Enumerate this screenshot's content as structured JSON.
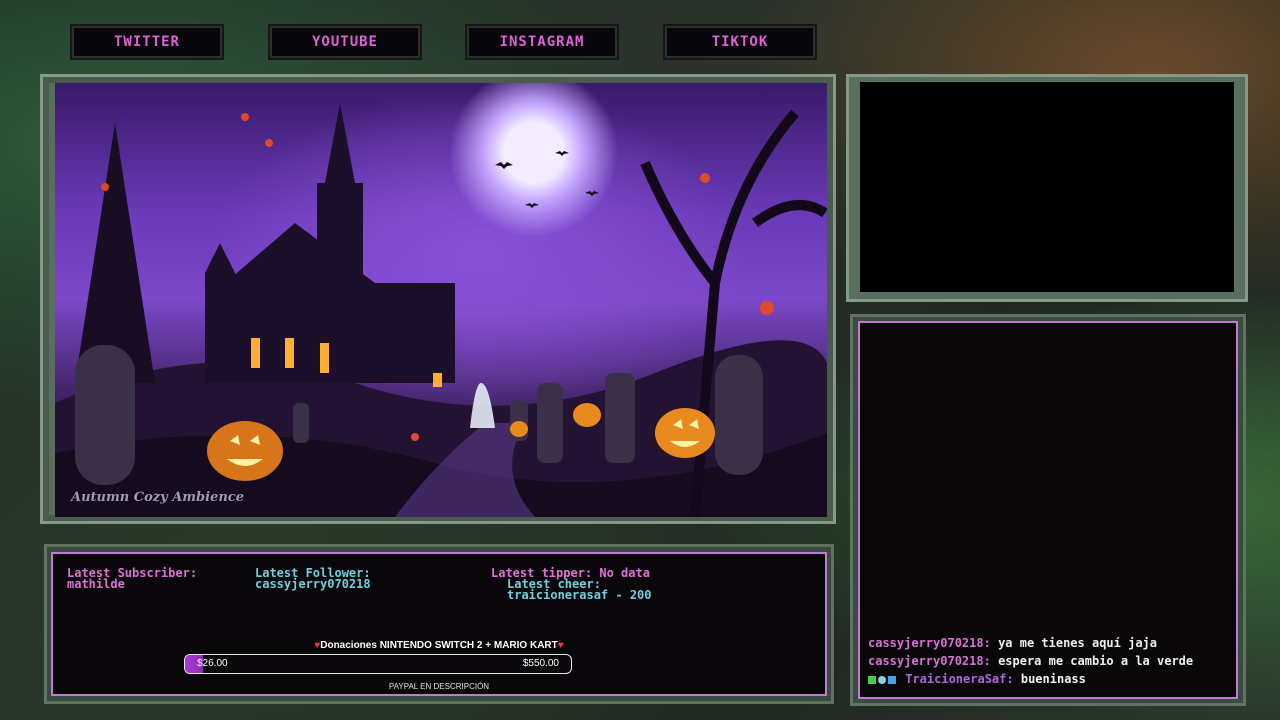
{
  "social_links": [
    "TWITTER",
    "YOUTUBE",
    "INSTAGRAM",
    "TIKTOK"
  ],
  "video": {
    "watermark": "Autumn Cozy Ambience"
  },
  "info": {
    "subscriber_label": "Latest Subscriber:",
    "subscriber_name": "mathilde",
    "follower_label": "Latest Follower:",
    "follower_name": "cassyjerry070218",
    "tipper": "Latest tipper: No data",
    "cheer_label": "Latest cheer:",
    "cheer_value": "traicionerasaf - 200",
    "donation_title": "Donaciones NINTENDO SWITCH 2 + MARIO KART",
    "donation_current": "$26.00",
    "donation_goal": "$550.00",
    "donation_progress": 0.047,
    "paypal_note": "PAYPAL EN DESCRIPCIÓN"
  },
  "chat": {
    "messages": [
      {
        "user": "cassyjerry070218:",
        "text": "ya me tienes aquí jaja",
        "badges": false
      },
      {
        "user": "cassyjerry070218:",
        "text": "espera me cambio a la verde",
        "badges": false
      },
      {
        "user": "TraicioneraSaf:",
        "text": "bueninass",
        "badges": true
      }
    ]
  },
  "colors": {
    "accent_pink": "#e070d8",
    "accent_teal": "#6ed0e0",
    "frame_green": "#849a86",
    "panel_border": "#c27ad0"
  }
}
